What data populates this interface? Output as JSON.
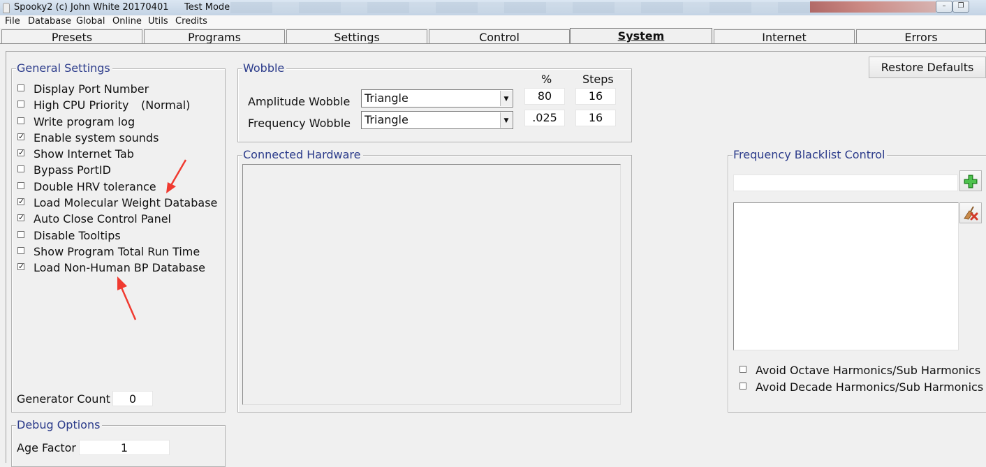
{
  "window": {
    "title": "Spooky2 (c) John White 20170401",
    "mode": "Test Mode",
    "minimize_glyph": "–",
    "restore_glyph": "❐"
  },
  "menu": [
    "File",
    "Database",
    "Global",
    "Online",
    "Utils",
    "Credits"
  ],
  "tabs": [
    "Presets",
    "Programs",
    "Settings",
    "Control",
    "System",
    "Internet",
    "Errors"
  ],
  "active_tab": "System",
  "general_settings": {
    "title": "General Settings",
    "options": [
      {
        "label": "Display Port Number",
        "checked": false
      },
      {
        "label": "High CPU Priority",
        "checked": false,
        "suffix": "(Normal)"
      },
      {
        "label": "Write program log",
        "checked": false
      },
      {
        "label": "Enable system sounds",
        "checked": true
      },
      {
        "label": "Show Internet Tab",
        "checked": true
      },
      {
        "label": "Bypass PortID",
        "checked": false
      },
      {
        "label": "Double HRV tolerance",
        "checked": false
      },
      {
        "label": "Load Molecular Weight Database",
        "checked": true
      },
      {
        "label": "Auto Close Control Panel",
        "checked": true
      },
      {
        "label": "Disable Tooltips",
        "checked": false
      },
      {
        "label": "Show Program Total Run Time",
        "checked": false
      },
      {
        "label": "Load Non-Human BP Database",
        "checked": true
      }
    ],
    "generator_count_label": "Generator Count",
    "generator_count_value": "0"
  },
  "debug_options": {
    "title": "Debug Options",
    "age_factor_label": "Age Factor",
    "age_factor_value": "1"
  },
  "wobble": {
    "title": "Wobble",
    "col_percent": "%",
    "col_steps": "Steps",
    "amplitude_label": "Amplitude Wobble",
    "amplitude_type": "Triangle",
    "amplitude_percent": "80",
    "amplitude_steps": "16",
    "frequency_label": "Frequency Wobble",
    "frequency_type": "Triangle",
    "frequency_percent": ".025",
    "frequency_steps": "16"
  },
  "connected_hardware": {
    "title": "Connected Hardware"
  },
  "restore_defaults": "Restore Defaults",
  "blacklist": {
    "title": "Frequency Blacklist Control",
    "input_value": "",
    "options": [
      {
        "label": "Avoid Octave Harmonics/Sub Harmonics",
        "checked": false
      },
      {
        "label": "Avoid Decade Harmonics/Sub Harmonics",
        "checked": false
      }
    ]
  },
  "colors": {
    "group_title": "#2a3a8a",
    "annotation_arrow": "#f03a30",
    "add_icon": "#2fa02f",
    "remove_icon": "#d23a2a"
  }
}
